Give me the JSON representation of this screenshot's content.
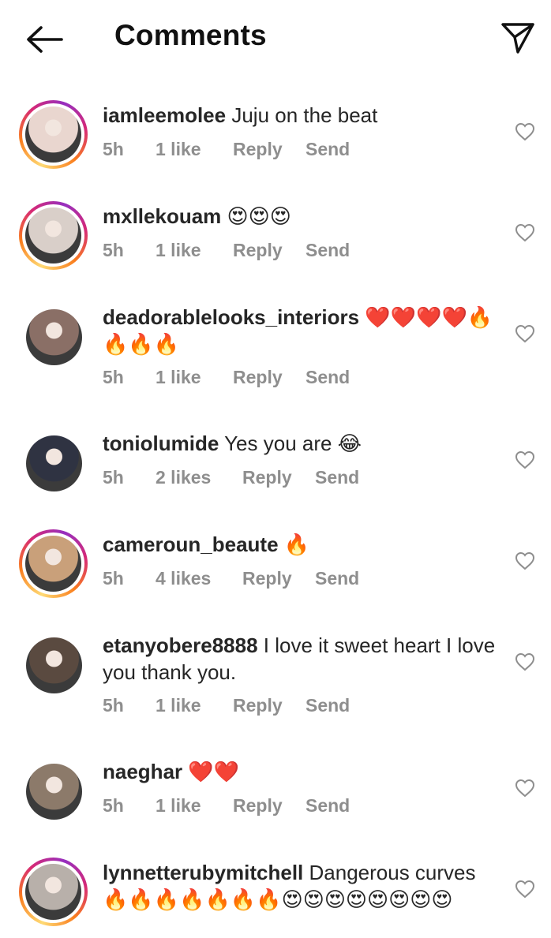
{
  "header": {
    "title": "Comments",
    "back_icon": "back-arrow-icon",
    "send_icon": "paper-plane-icon"
  },
  "colors": {
    "ring_start": "#feda75",
    "ring_mid": "#d62976",
    "ring_end": "#962fbf",
    "meta_text": "#8e8e8e"
  },
  "comments": [
    {
      "username": "iamleemolee",
      "text": "Juju on the beat",
      "time": "5h",
      "likes": "1 like",
      "reply": "Reply",
      "send": "Send",
      "has_story_ring": true,
      "avatar_color": "#e9d6cf"
    },
    {
      "username": "mxllekouam",
      "text": "😍😍😍",
      "time": "5h",
      "likes": "1 like",
      "reply": "Reply",
      "send": "Send",
      "has_story_ring": true,
      "avatar_color": "#d9cfc9"
    },
    {
      "username": "deadorablelooks_interiors",
      "text": "❤️❤️❤️❤️🔥🔥🔥🔥",
      "time": "5h",
      "likes": "1 like",
      "reply": "Reply",
      "send": "Send",
      "has_story_ring": false,
      "avatar_color": "#8a6f66"
    },
    {
      "username": "toniolumide",
      "text": "Yes you are 😂",
      "time": "5h",
      "likes": "2 likes",
      "reply": "Reply",
      "send": "Send",
      "has_story_ring": false,
      "avatar_color": "#2f3342"
    },
    {
      "username": "cameroun_beaute",
      "text": "🔥",
      "time": "5h",
      "likes": "4 likes",
      "reply": "Reply",
      "send": "Send",
      "has_story_ring": true,
      "avatar_color": "#c9a07a"
    },
    {
      "username": "etanyobere8888",
      "text": "I love it sweet heart I love you thank you.",
      "time": "5h",
      "likes": "1 like",
      "reply": "Reply",
      "send": "Send",
      "has_story_ring": false,
      "avatar_color": "#5a4a40"
    },
    {
      "username": "naeghar",
      "text": "❤️❤️",
      "time": "5h",
      "likes": "1 like",
      "reply": "Reply",
      "send": "Send",
      "has_story_ring": false,
      "avatar_color": "#8c7a6a"
    },
    {
      "username": "lynnetterubymitchell",
      "text": "Dangerous curves 🔥🔥🔥🔥🔥🔥🔥😍😍😍😍😍😍😍😍",
      "time": "",
      "likes": "",
      "reply": "",
      "send": "",
      "has_story_ring": true,
      "avatar_color": "#b8b0aa"
    }
  ]
}
